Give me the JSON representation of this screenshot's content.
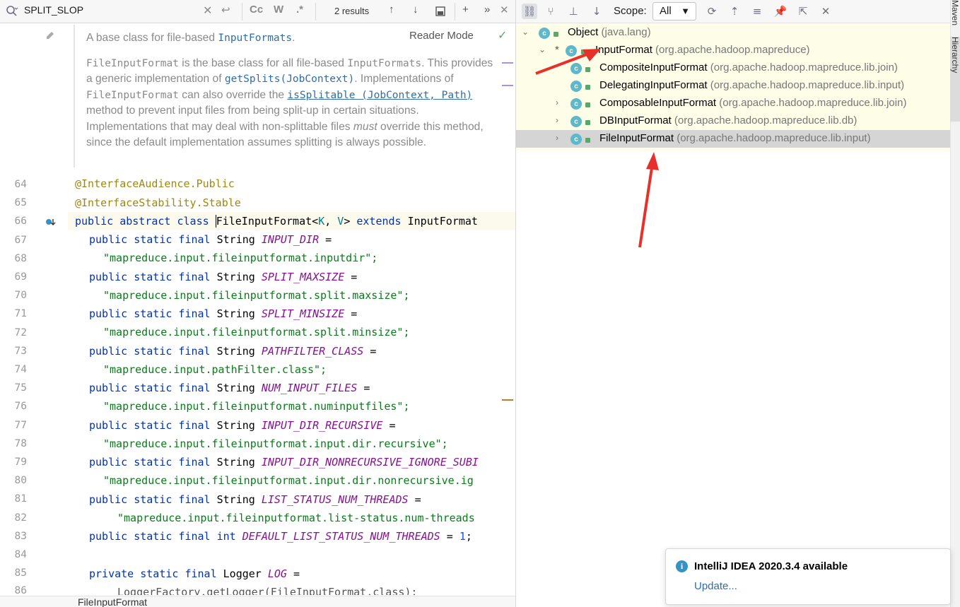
{
  "search": {
    "query": "SPLIT_SLOP",
    "results": "2 results",
    "case_label": "Cc",
    "word_label": "W",
    "regex_label": ".*"
  },
  "doc": {
    "summary_pre": "A base class for file-based ",
    "summary_code": "InputFormats",
    "summary_post": ".",
    "reader_mode": "Reader Mode",
    "p1_code1": "FileInputFormat",
    "p1_t1": " is the base class for all file-based ",
    "p1_code2": "InputFormats",
    "p1_t2": ". This provides a generic implementation of ",
    "p1_link1": "getSplits(JobContext)",
    "p1_t3": ". Implementations of ",
    "p1_code3": "FileInputFormat",
    "p1_t4": " can also override the ",
    "p1_link2": "isSplitable (JobContext, Path)",
    "p1_t5": " method to prevent input files from being split-up in certain situations. Implementations that may deal with non-splittable files ",
    "p1_em": "must",
    "p1_t6": " override this method, since the default implementation assumes splitting is always possible."
  },
  "lines": [
    {
      "n": "64"
    },
    {
      "n": "65"
    },
    {
      "n": "66"
    },
    {
      "n": "67"
    },
    {
      "n": "68"
    },
    {
      "n": "69"
    },
    {
      "n": "70"
    },
    {
      "n": "71"
    },
    {
      "n": "72"
    },
    {
      "n": "73"
    },
    {
      "n": "74"
    },
    {
      "n": "75"
    },
    {
      "n": "76"
    },
    {
      "n": "77"
    },
    {
      "n": "78"
    },
    {
      "n": "79"
    },
    {
      "n": "80"
    },
    {
      "n": "81"
    },
    {
      "n": "82"
    },
    {
      "n": "83"
    },
    {
      "n": "84"
    },
    {
      "n": "85"
    },
    {
      "n": "86"
    }
  ],
  "code": {
    "l64_ann": "@InterfaceAudience",
    "l64_rest": ".Public",
    "l65_ann": "@InterfaceStability",
    "l65_rest": ".Stable",
    "l66_kw": "public abstract class ",
    "l66_cls": "FileInputFormat",
    "l66_g1": "<",
    "l66_k": "K",
    "l66_c": ", ",
    "l66_v": "V",
    "l66_g2": "> ",
    "l66_ext": "extends ",
    "l66_parent": "InputFormat",
    "kw_psfs": "public static final ",
    "t_string": "String ",
    "t_int": "int ",
    "f_input_dir": "INPUT_DIR",
    "s_input_dir": "\"mapreduce.input.fileinputformat.inputdir\";",
    "f_split_max": "SPLIT_MAXSIZE",
    "s_split_max": "\"mapreduce.input.fileinputformat.split.maxsize\";",
    "f_split_min": "SPLIT_MINSIZE",
    "s_split_min": "\"mapreduce.input.fileinputformat.split.minsize\";",
    "f_pathfilter": "PATHFILTER_CLASS",
    "s_pathfilter": "\"mapreduce.input.pathFilter.class\";",
    "f_num_files": "NUM_INPUT_FILES",
    "s_num_files": "\"mapreduce.input.fileinputformat.numinputfiles\";",
    "f_recursive": "INPUT_DIR_RECURSIVE",
    "s_recursive": "\"mapreduce.input.fileinputformat.input.dir.recursive\";",
    "f_nonrec": "INPUT_DIR_NONRECURSIVE_IGNORE_SUBI",
    "s_nonrec": "\"mapreduce.input.fileinputformat.input.dir.nonrecursive.ig",
    "f_threads": "LIST_STATUS_NUM_THREADS",
    "s_threads": "\"mapreduce.input.fileinputformat.list-status.num-threads",
    "f_def_threads": "DEFAULT_LIST_STATUS_NUM_THREADS",
    "v_def_threads": "1",
    "eq": " =",
    "eq_mid": " = ",
    "semi": ";",
    "kw_private": "private static final ",
    "t_logger": "Logger ",
    "f_log": "LOG",
    "l86": "LoggerFactory.getLogger(FileInputFormat.class);"
  },
  "breadcrumb": "FileInputFormat",
  "hierarchy": {
    "scope_label": "Scope:",
    "scope_value": "All",
    "side_tab": "Hierarchy",
    "side_tab_top": "Maven",
    "nodes": [
      {
        "name": "Object",
        "pkg": "(java.lang)"
      },
      {
        "name": "InputFormat",
        "pkg": "(org.apache.hadoop.mapreduce)"
      },
      {
        "name": "CompositeInputFormat",
        "pkg": "(org.apache.hadoop.mapreduce.lib.join)"
      },
      {
        "name": "DelegatingInputFormat",
        "pkg": "(org.apache.hadoop.mapreduce.lib.input)"
      },
      {
        "name": "ComposableInputFormat",
        "pkg": "(org.apache.hadoop.mapreduce.lib.join)"
      },
      {
        "name": "DBInputFormat",
        "pkg": "(org.apache.hadoop.mapreduce.lib.db)"
      },
      {
        "name": "FileInputFormat",
        "pkg": "(org.apache.hadoop.mapreduce.lib.input)"
      }
    ]
  },
  "notification": {
    "title": "IntelliJ IDEA 2020.3.4 available",
    "link": "Update..."
  },
  "colors": {
    "keyword": "#0033b3",
    "string": "#067d17",
    "field": "#871094",
    "annotation": "#9e880d",
    "tree_bg": "#fefde7",
    "arrow": "#e8302a"
  }
}
